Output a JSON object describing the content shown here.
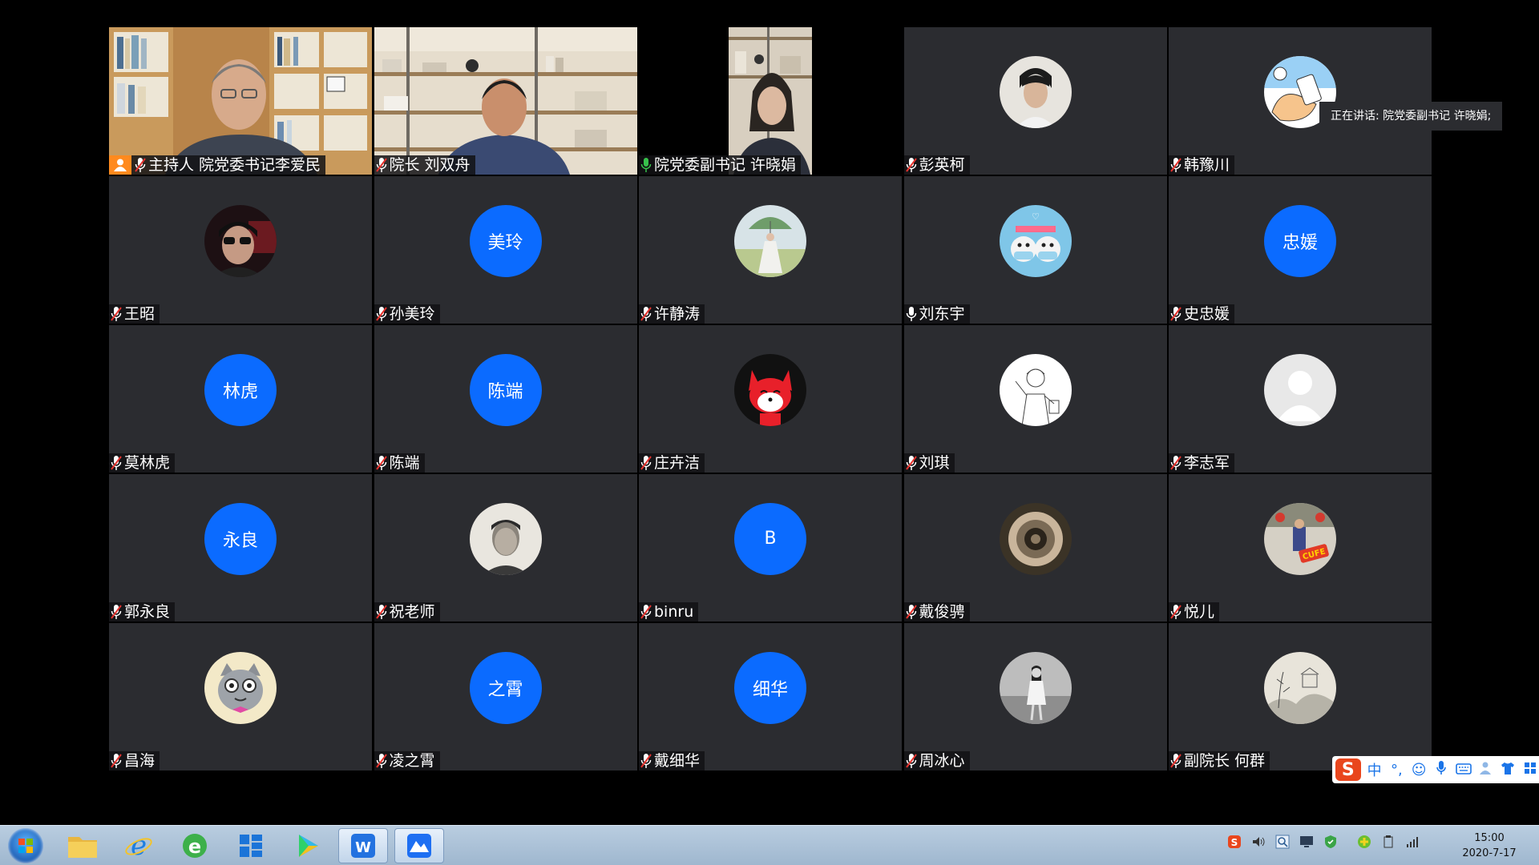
{
  "speaking_notice": "正在讲话: 院党委副书记 许晓娟;",
  "colors": {
    "tile_bg": "#2b2c30",
    "initials_avatar_bg": "#0b6bff",
    "host_badge": "#ff8a1e",
    "speaking_border": "#3c8a4e"
  },
  "participants": [
    {
      "name": "主持人 院党委书记李爱民",
      "host": true,
      "video": "bookshelf-man",
      "mic": "muted"
    },
    {
      "name": "院长 刘双舟",
      "video": "study-man",
      "mic": "muted"
    },
    {
      "name": "院党委副书记 许晓娟",
      "video": "woman-speaking",
      "mic": "active",
      "speaking": true
    },
    {
      "name": "彭英柯",
      "avatar": "photo-young-man",
      "mic": "muted"
    },
    {
      "name": "韩豫川",
      "avatar": "cartoon-hand-phone",
      "mic": "muted"
    },
    {
      "name": "王昭",
      "avatar": "photo-sunglasses",
      "mic": "muted"
    },
    {
      "name": "孙美玲",
      "initials": "美玲",
      "mic": "muted"
    },
    {
      "name": "许静涛",
      "avatar": "painting-woman-parasol",
      "mic": "muted"
    },
    {
      "name": "刘东宇",
      "avatar": "cartoon-masks",
      "mic": "unmuted"
    },
    {
      "name": "史忠媛",
      "initials": "忠媛",
      "mic": "muted"
    },
    {
      "name": "莫林虎",
      "initials": "林虎",
      "mic": "muted"
    },
    {
      "name": "陈端",
      "initials": "陈端",
      "mic": "muted"
    },
    {
      "name": "庄卉洁",
      "avatar": "cartoon-red-fox",
      "mic": "muted"
    },
    {
      "name": "刘琪",
      "avatar": "sketch-person",
      "mic": "muted"
    },
    {
      "name": "李志军",
      "avatar": "default-gray",
      "mic": "muted"
    },
    {
      "name": "郭永良",
      "initials": "永良",
      "mic": "muted"
    },
    {
      "name": "祝老师",
      "avatar": "photo-bw-man",
      "mic": "muted"
    },
    {
      "name": "binru",
      "initials": "B",
      "mic": "muted"
    },
    {
      "name": "戴俊骋",
      "avatar": "photo-teacup",
      "mic": "muted"
    },
    {
      "name": "悦儿",
      "avatar": "photo-cufe-sign",
      "mic": "muted"
    },
    {
      "name": "昌海",
      "avatar": "cartoon-cat",
      "mic": "muted"
    },
    {
      "name": "凌之霄",
      "initials": "之霄",
      "mic": "muted"
    },
    {
      "name": "戴细华",
      "initials": "细华",
      "mic": "muted"
    },
    {
      "name": "周冰心",
      "avatar": "photo-bw-woman",
      "mic": "muted"
    },
    {
      "name": "副院长 何群",
      "avatar": "painting-ink-landscape",
      "mic": "muted"
    }
  ],
  "ime": {
    "logo": "S",
    "items": [
      "中",
      "°,",
      "☺",
      "mic-icon",
      "keyboard-icon",
      "person-icon",
      "shirt-icon",
      "grid-icon"
    ]
  },
  "taskbar": {
    "apps": [
      "start-icon",
      "file-explorer-icon",
      "internet-explorer-icon",
      "ie-green-icon",
      "tiles-icon",
      "player-icon",
      "wps-icon",
      "tencent-meeting-icon"
    ],
    "time": "15:00",
    "date": "2020-7-17"
  }
}
